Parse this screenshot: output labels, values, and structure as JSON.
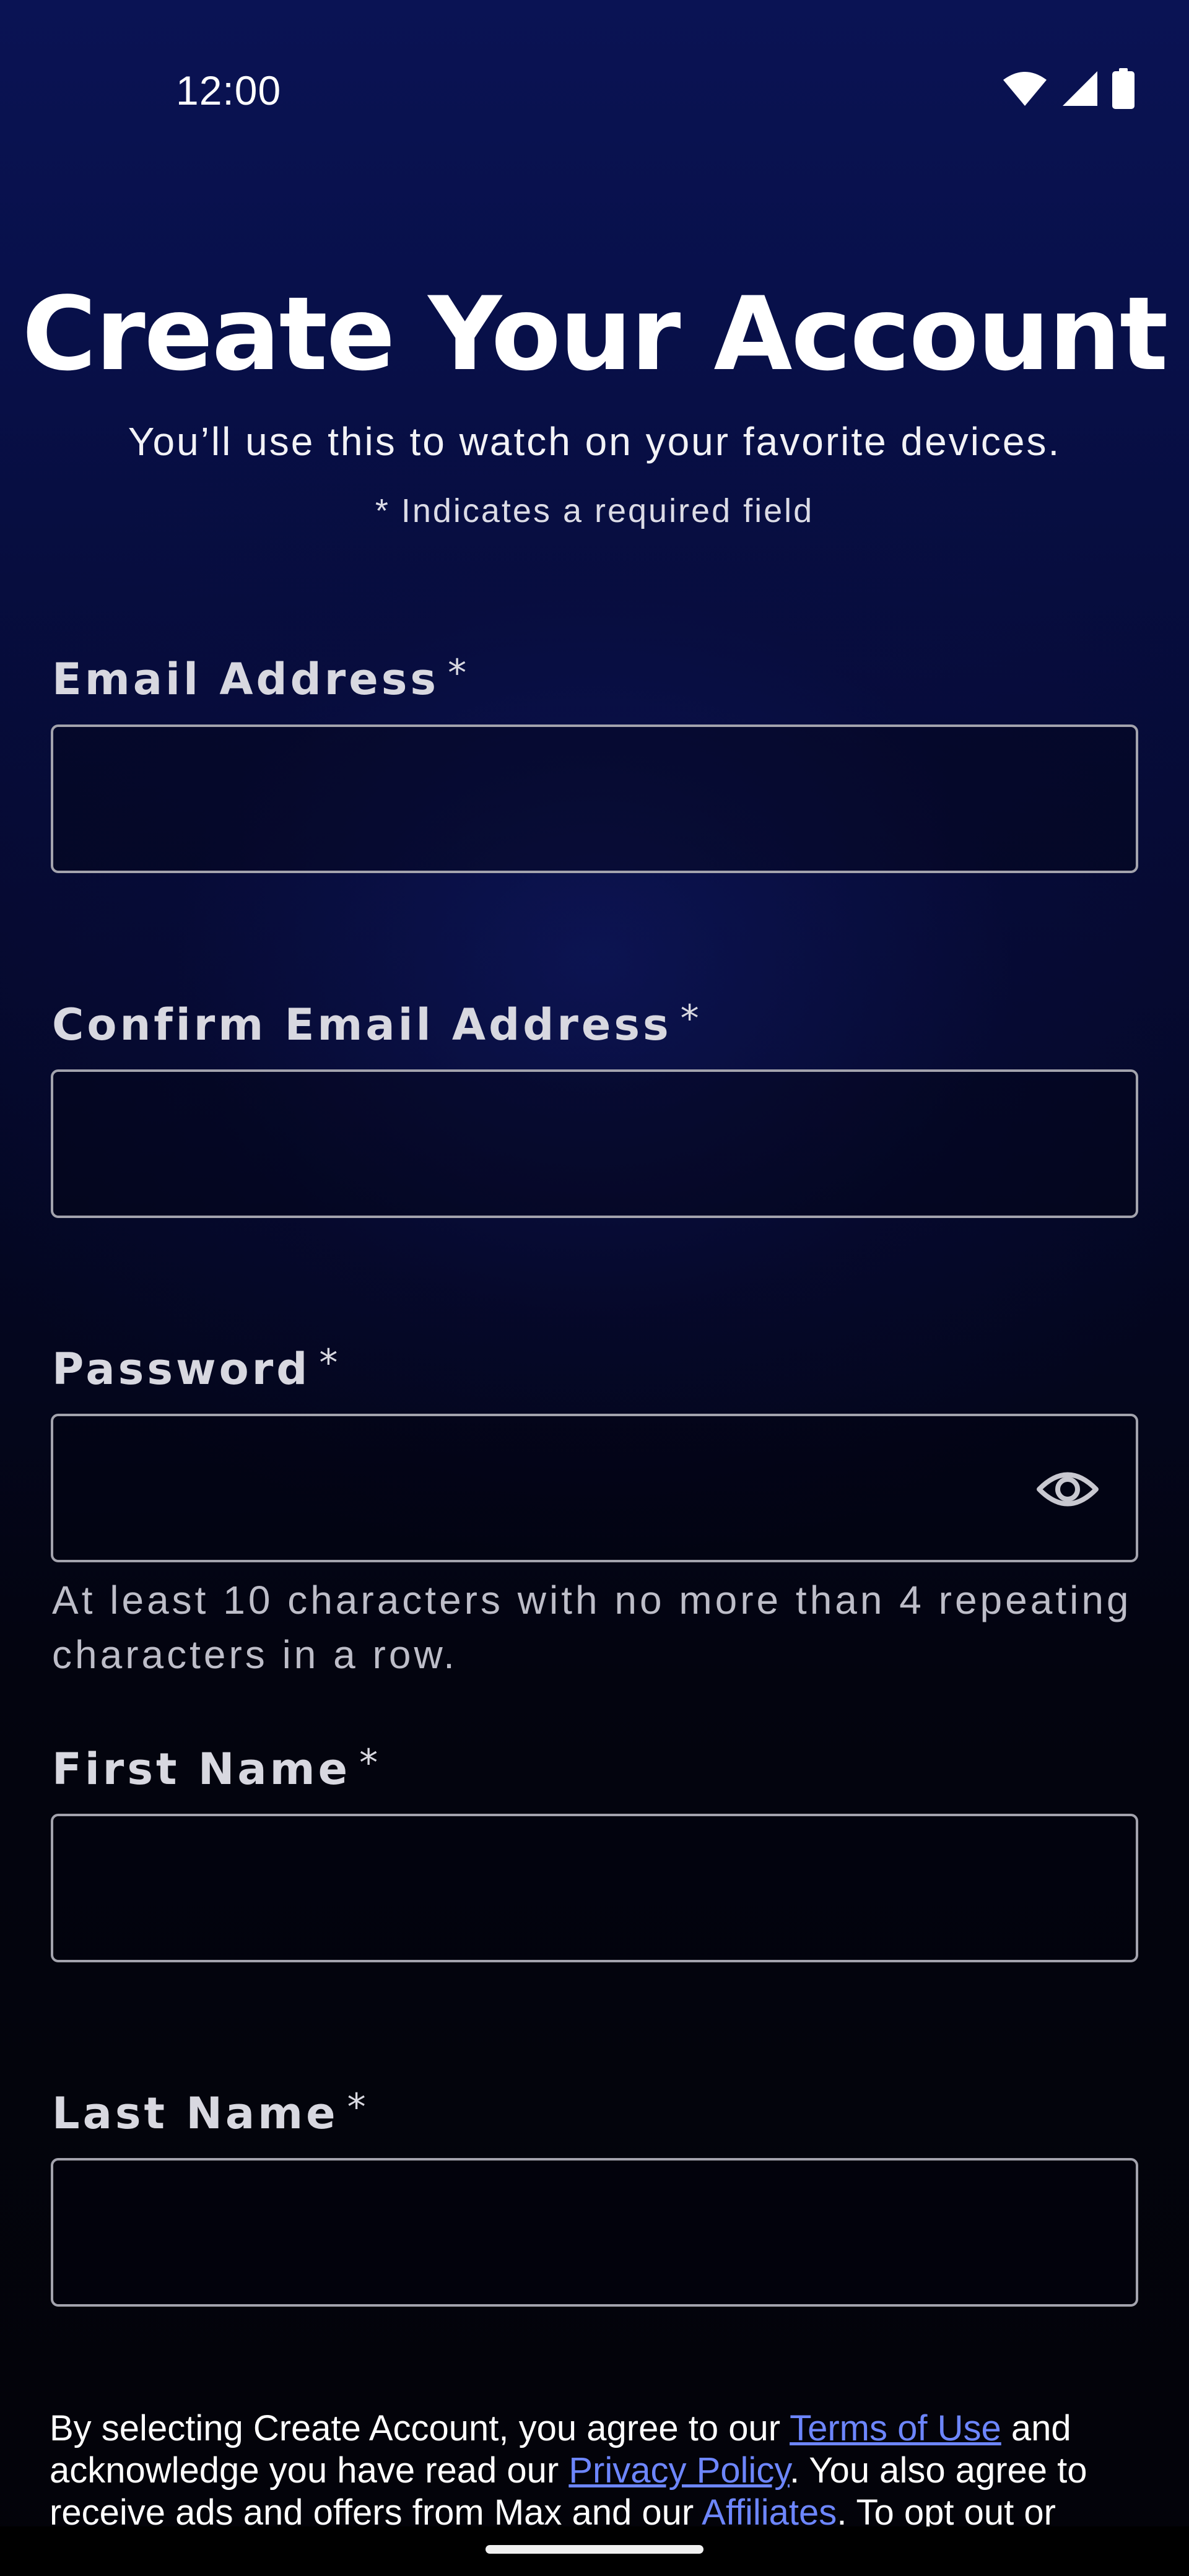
{
  "status_bar": {
    "time": "12:00",
    "icons": [
      "wifi-icon",
      "cellular-signal-icon",
      "battery-icon"
    ]
  },
  "header": {
    "title": "Create Your Account",
    "subtitle": "You’ll use this to watch on your favorite devices.",
    "required_note": "* Indicates a required field"
  },
  "form": {
    "email": {
      "label": "Email Address",
      "required_mark": "*",
      "value": ""
    },
    "confirm_email": {
      "label": "Confirm Email Address",
      "required_mark": "*",
      "value": ""
    },
    "password": {
      "label": "Password",
      "required_mark": "*",
      "value": "",
      "toggle_icon": "eye-icon",
      "hint": "At least 10 characters with no more than 4 repeating characters in a row."
    },
    "first_name": {
      "label": "First Name",
      "required_mark": "*",
      "value": ""
    },
    "last_name": {
      "label": "Last Name",
      "required_mark": "*",
      "value": ""
    }
  },
  "legal": {
    "text_1": "By selecting Create Account, you agree to our ",
    "terms_link": "Terms of Use",
    "text_2": " and acknowledge you have read our ",
    "privacy_link": "Privacy Policy",
    "text_3": ". You also agree to receive ads and offers from Max and our ",
    "affiliates_link": "Affiliates",
    "text_4": ". To opt out or"
  },
  "colors": {
    "background_top": "#0a1354",
    "background_bottom": "#030309",
    "link": "#6d86ff",
    "input_border": "#a3a3ad"
  }
}
